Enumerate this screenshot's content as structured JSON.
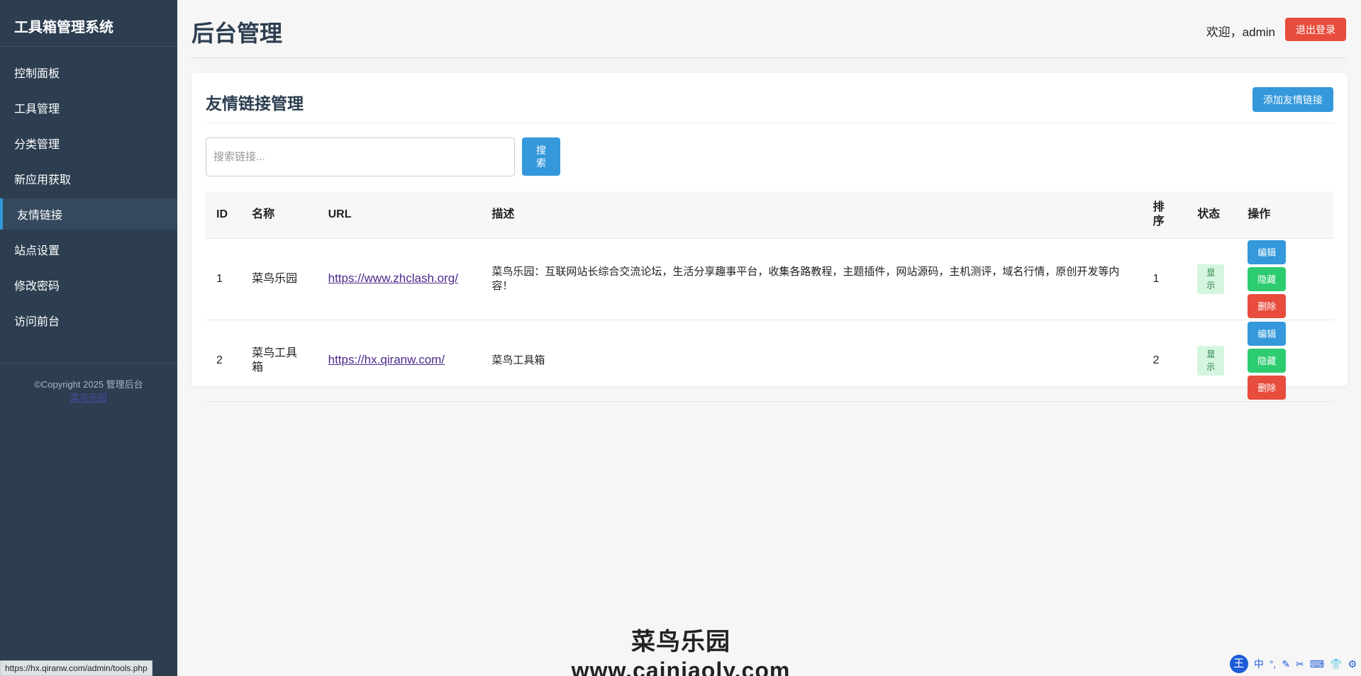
{
  "sidebar": {
    "brand": "工具箱管理系统",
    "items": [
      {
        "label": "控制面板"
      },
      {
        "label": "工具管理"
      },
      {
        "label": "分类管理"
      },
      {
        "label": "新应用获取"
      },
      {
        "label": "友情链接"
      },
      {
        "label": "站点设置"
      },
      {
        "label": "修改密码"
      },
      {
        "label": "访问前台"
      }
    ],
    "copyright": "©Copyright 2025 管理后台",
    "copyright_link": "菜鸟乐园"
  },
  "header": {
    "title": "后台管理",
    "welcome": "欢迎，admin",
    "logout_label": "退出登录"
  },
  "card": {
    "title": "友情链接管理",
    "add_label": "添加友情链接"
  },
  "search": {
    "placeholder": "搜索链接...",
    "button_label": "搜索"
  },
  "table": {
    "headers": [
      "ID",
      "名称",
      "URL",
      "描述",
      "排序",
      "状态",
      "操作"
    ],
    "rows": [
      {
        "id": "1",
        "name": "菜鸟乐园",
        "url": "https://www.zhclash.org/",
        "desc": "菜鸟乐园：互联网站长综合交流论坛，生活分享趣事平台，收集各路教程，主题插件，网站源码，主机测评，域名行情，原创开发等内容！",
        "order": "1",
        "status": "显示",
        "edit": "编辑",
        "hide": "隐藏",
        "delete": "删除"
      },
      {
        "id": "2",
        "name": "菜鸟工具箱",
        "url": "https://hx.qiranw.com/",
        "desc": "菜鸟工具箱",
        "order": "2",
        "status": "显示",
        "edit": "编辑",
        "hide": "隐藏",
        "delete": "删除"
      }
    ]
  },
  "statusbar": {
    "url": "https://hx.qiranw.com/admin/tools.php"
  },
  "watermark": {
    "title": "菜鸟乐园",
    "site": "www.cainiaoly.com"
  },
  "ime": {
    "logo": "王",
    "mode": "中",
    "punct": "°,"
  },
  "colors": {
    "sidebar_bg": "#2c3e50",
    "primary": "#3498db",
    "danger": "#e74c3c",
    "success": "#2ecc71"
  }
}
